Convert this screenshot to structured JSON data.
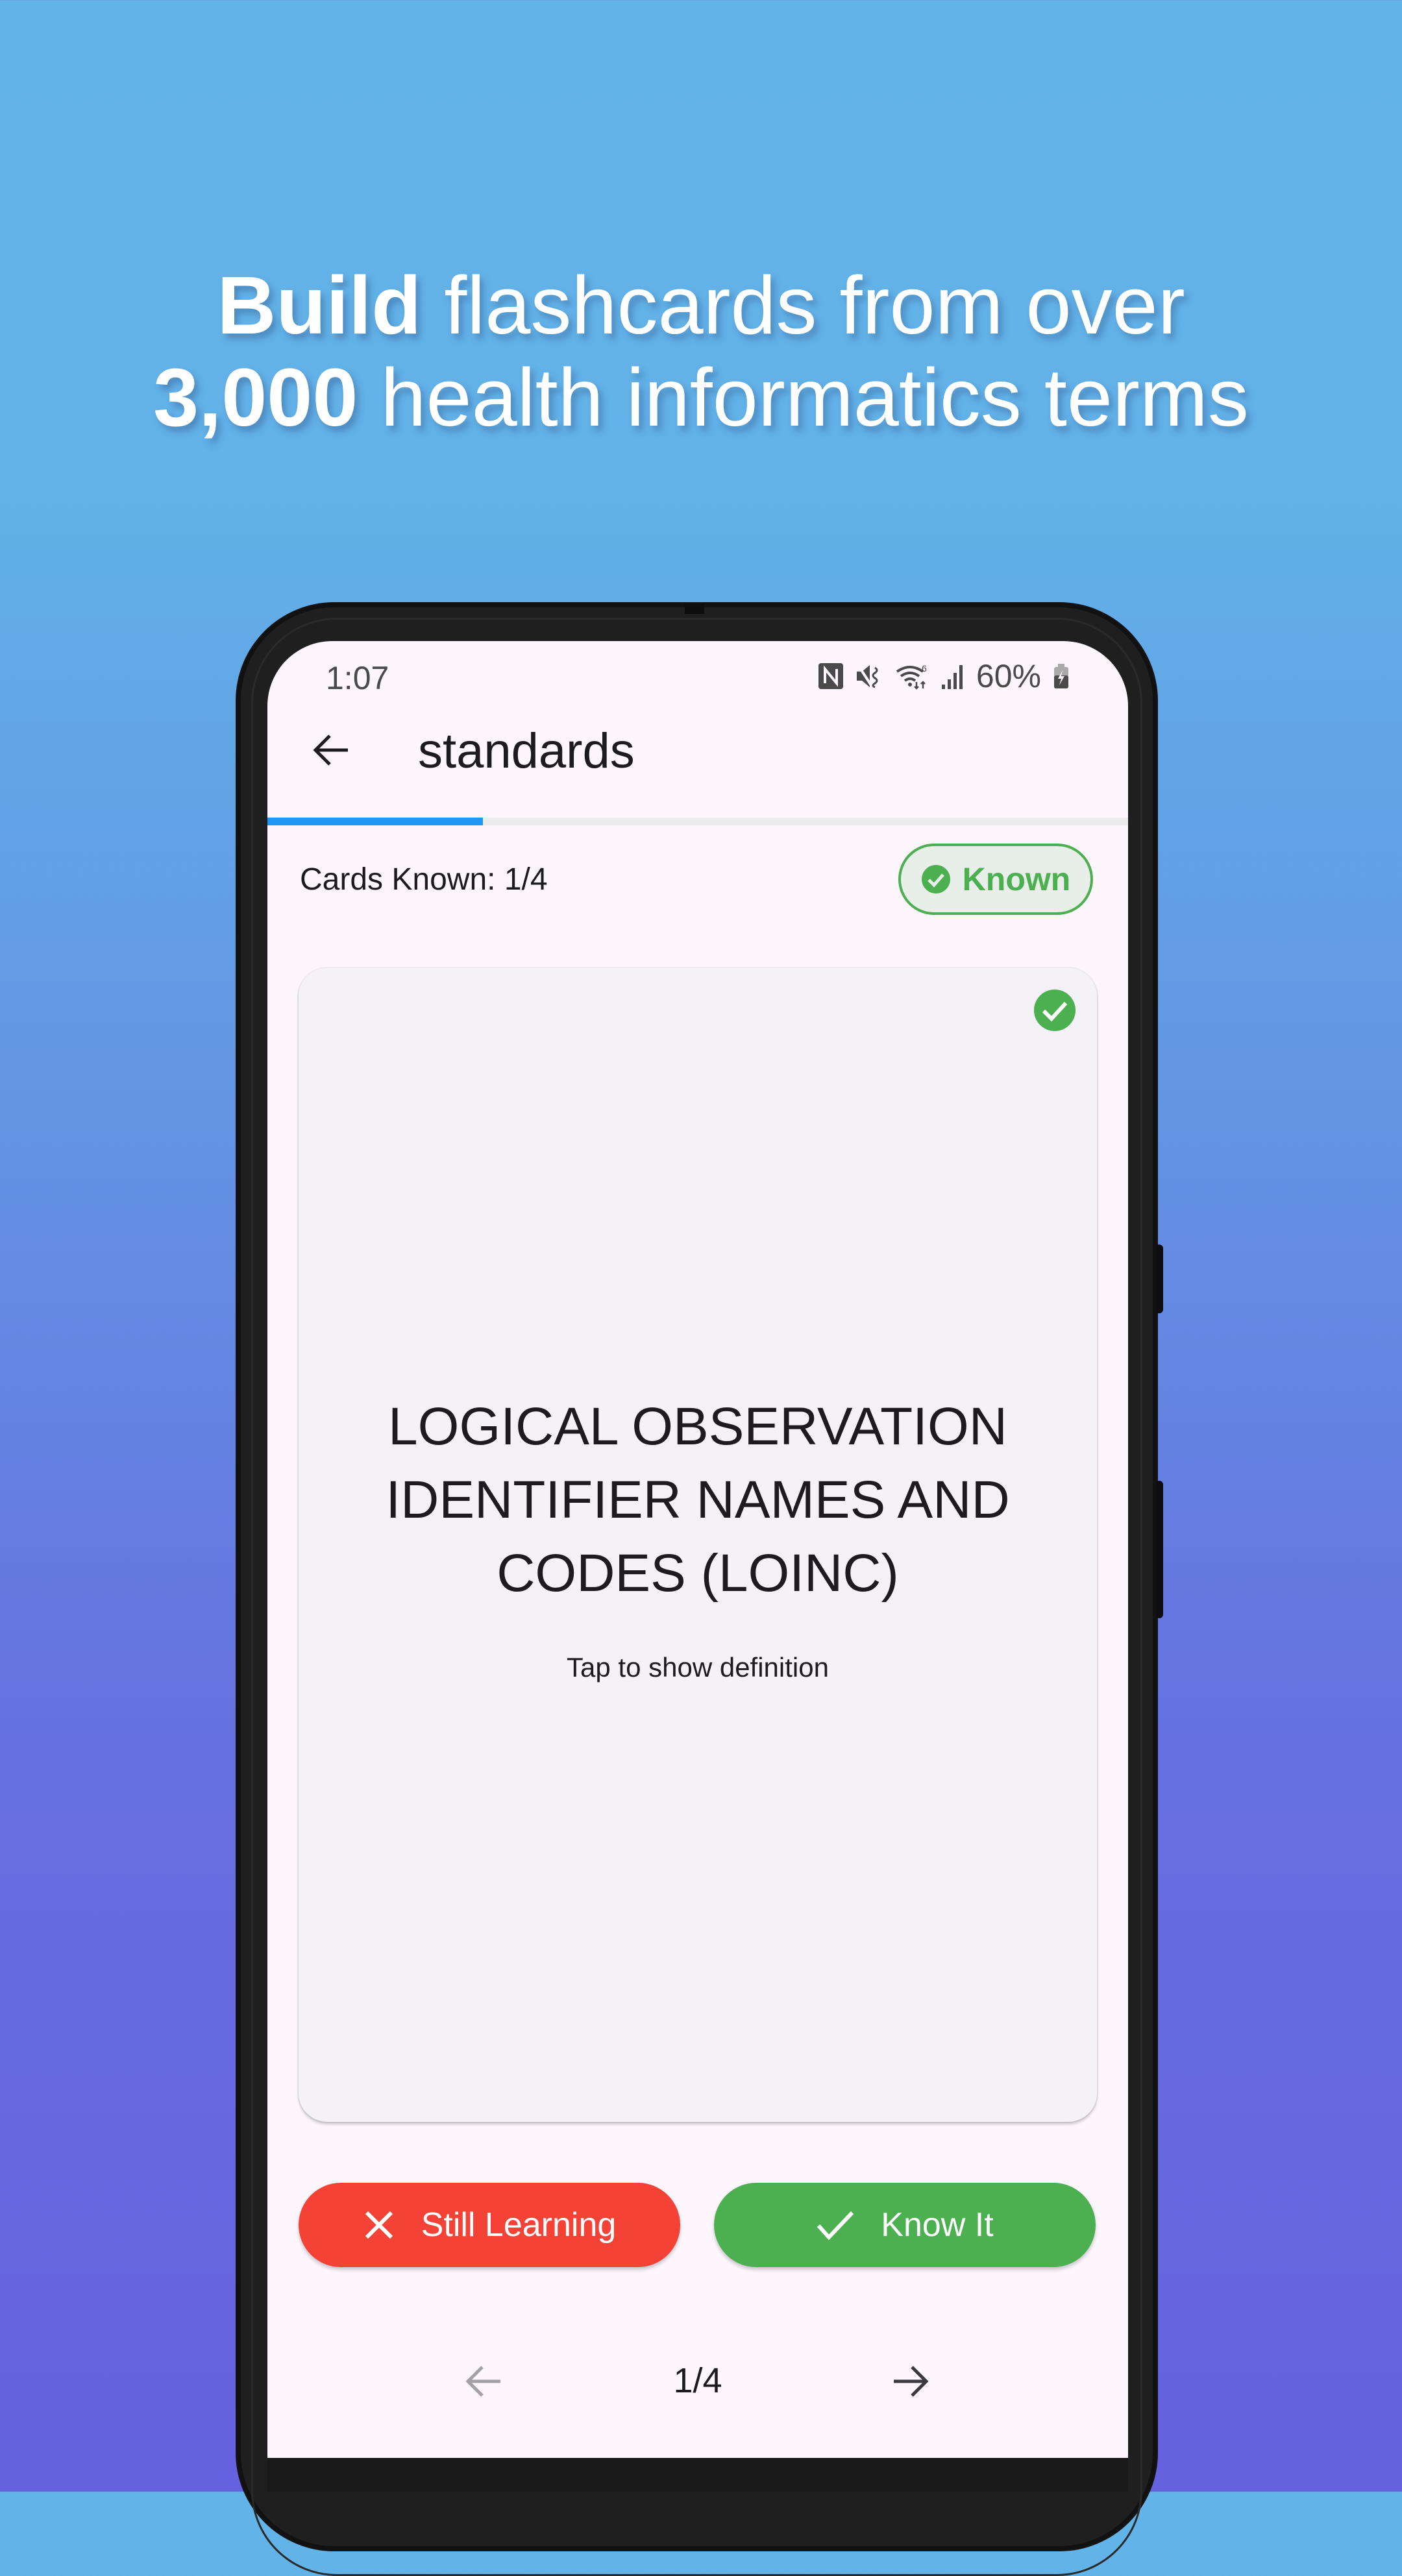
{
  "headline": {
    "line1_bold": "Build",
    "line1_rest": " flashcards from over",
    "line2_bold": "3,000",
    "line2_rest": " health informatics terms"
  },
  "status_bar": {
    "time": "1:07",
    "icons": [
      "nfc-icon",
      "mute-icon",
      "wifi-6-icon",
      "signal-icon"
    ],
    "battery_percent": "60%",
    "battery_icon": "battery-charging-icon"
  },
  "app_bar": {
    "back_icon": "arrow-back-icon",
    "title": "standards"
  },
  "progress": {
    "known": 1,
    "total": 4,
    "fraction": 0.25,
    "color": "#2196f3"
  },
  "summary": {
    "cards_known_label": "Cards Known: 1/4",
    "known_chip_label": "Known",
    "known_chip_icon": "check-circle-icon"
  },
  "card": {
    "term": "LOGICAL OBSERVATION IDENTIFIER NAMES AND CODES (LOINC)",
    "hint": "Tap to show definition",
    "status_icon": "check-circle-icon",
    "is_known": true
  },
  "actions": {
    "still_learning_label": "Still Learning",
    "still_learning_icon": "close-icon",
    "know_it_label": "Know It",
    "know_it_icon": "check-icon"
  },
  "pager": {
    "page_label": "1/4",
    "prev_icon": "arrow-back-icon",
    "next_icon": "arrow-forward-icon",
    "prev_enabled": false,
    "next_enabled": true
  },
  "colors": {
    "accent_blue": "#2196f3",
    "success_green": "#4caf50",
    "danger_red": "#f44336",
    "screen_bg": "#fdf7fd",
    "card_bg": "#f5f2f7"
  }
}
